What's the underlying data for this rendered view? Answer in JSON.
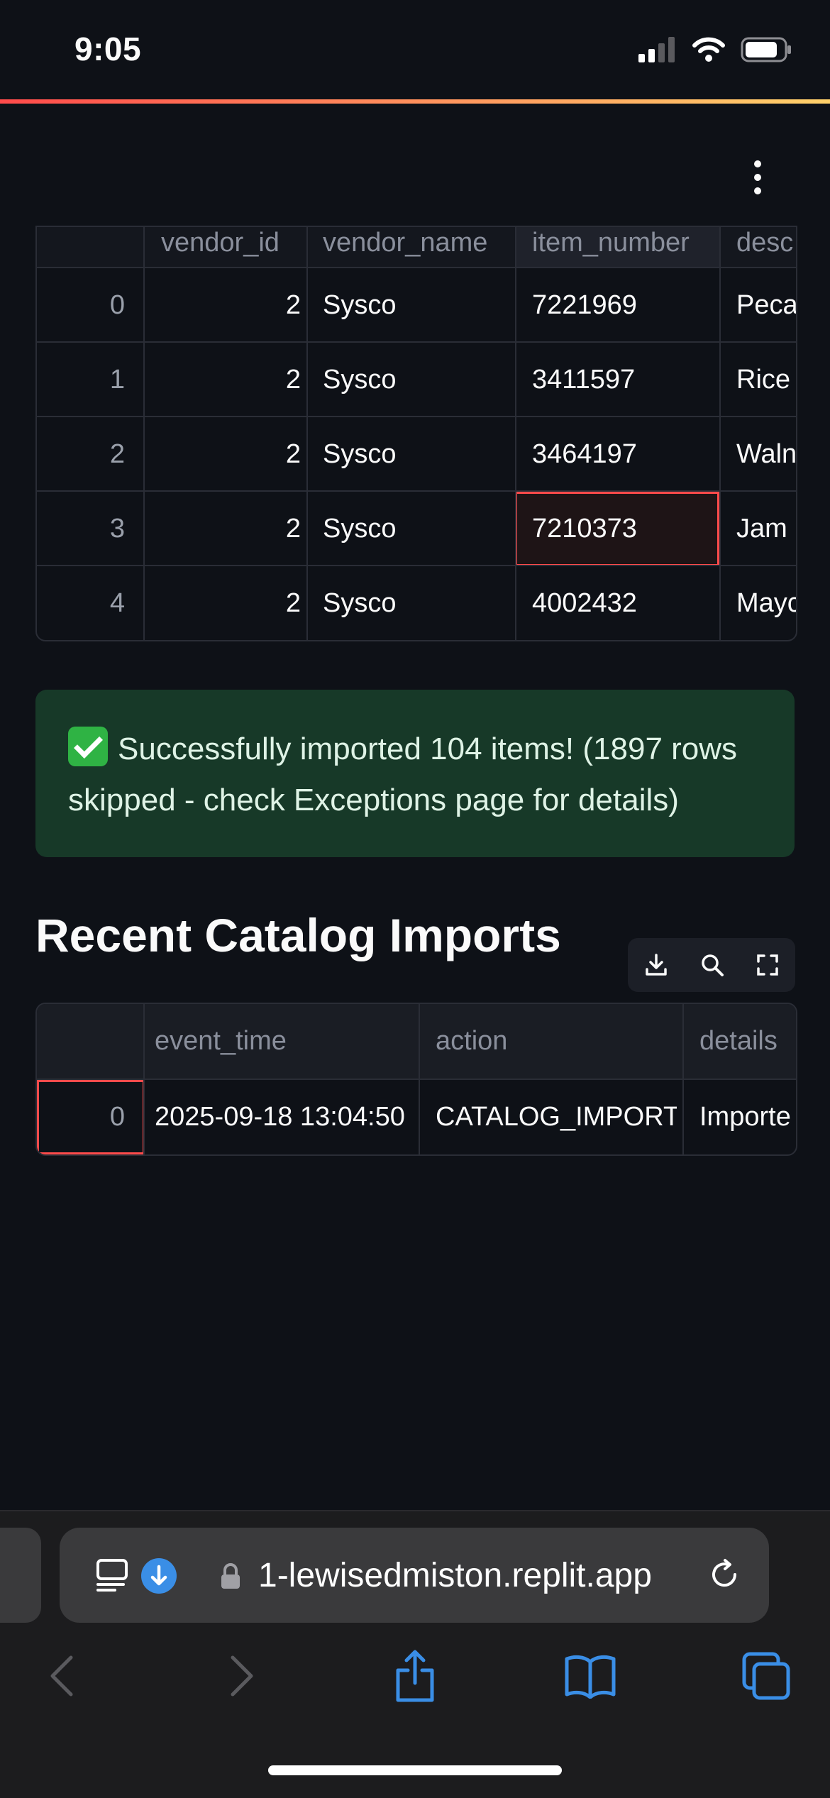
{
  "status_bar": {
    "time": "9:05"
  },
  "top_table": {
    "headers": [
      "",
      "vendor_id",
      "vendor_name",
      "item_number",
      "desc"
    ],
    "rows": [
      {
        "index": "0",
        "vendor_id": "2",
        "vendor_name": "Sysco",
        "item_number": "7221969",
        "description": "Peca"
      },
      {
        "index": "1",
        "vendor_id": "2",
        "vendor_name": "Sysco",
        "item_number": "3411597",
        "description": "Rice ."
      },
      {
        "index": "2",
        "vendor_id": "2",
        "vendor_name": "Sysco",
        "item_number": "3464197",
        "description": "Waln"
      },
      {
        "index": "3",
        "vendor_id": "2",
        "vendor_name": "Sysco",
        "item_number": "7210373",
        "description": "Jam"
      },
      {
        "index": "4",
        "vendor_id": "2",
        "vendor_name": "Sysco",
        "item_number": "4002432",
        "description": "Mayc"
      }
    ]
  },
  "success_message": "Successfully imported 104 items! (1897 rows skipped - check Exceptions page for details)",
  "section_title": "Recent Catalog Imports",
  "imports_table": {
    "headers": [
      "",
      "event_time",
      "action",
      "details"
    ],
    "rows": [
      {
        "index": "0",
        "event_time": "2025-09-18 13:04:50",
        "action": "CATALOG_IMPORT",
        "details": "Importe"
      }
    ]
  },
  "toolbar_icons": [
    "download-icon",
    "search-icon",
    "fullscreen-icon"
  ],
  "browser": {
    "url": "1-lewisedmiston.replit.app",
    "nav_icons": [
      "back-icon",
      "forward-icon",
      "share-icon",
      "bookmarks-icon",
      "tabs-icon"
    ]
  },
  "colors": {
    "background": "#0e1117",
    "accent_red": "#ff4b4b",
    "success_bg": "#173928",
    "link_blue": "#3a8ee6"
  }
}
